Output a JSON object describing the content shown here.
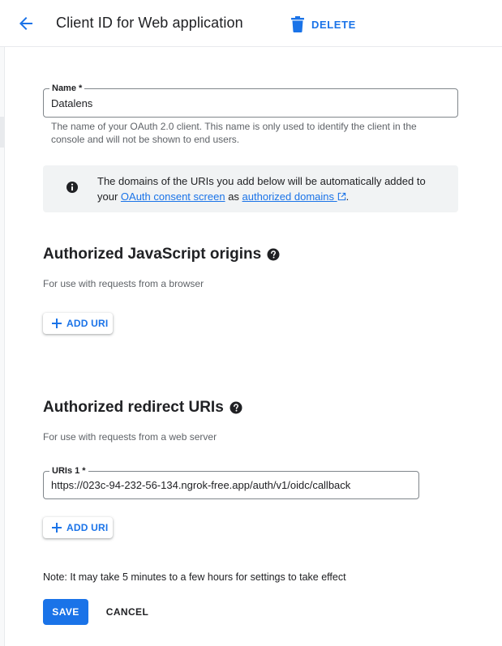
{
  "header": {
    "title": "Client ID for Web application",
    "delete_label": "DELETE",
    "back_icon": "arrow-back-icon",
    "delete_icon": "trash-icon"
  },
  "name_field": {
    "label": "Name *",
    "value": "Datalens",
    "helper": "The name of your OAuth 2.0 client. This name is only used to identify the client in the console and will not be shown to end users."
  },
  "info_box": {
    "icon": "info-icon",
    "text_part1": "The domains of the URIs you add below will be automatically added to your",
    "link1": "OAuth consent screen",
    "text_part2": "as",
    "link2": "authorized domains",
    "text_part3": "."
  },
  "js_origins": {
    "title": "Authorized JavaScript origins",
    "subtitle": "For use with requests from a browser",
    "add_label": "ADD URI"
  },
  "redirect_uris": {
    "title": "Authorized redirect URIs",
    "subtitle": "For use with requests from a web server",
    "uri_label": "URIs 1 *",
    "uri_value": "https://023c-94-232-56-134.ngrok-free.app/auth/v1/oidc/callback",
    "add_label": "ADD URI"
  },
  "note": "Note: It may take 5 minutes to a few hours for settings to take effect",
  "actions": {
    "save_label": "SAVE",
    "cancel_label": "CANCEL"
  },
  "colors": {
    "accent": "#1a73e8",
    "text": "#202124",
    "muted": "#5f6368",
    "info_bg": "#f1f3f4"
  }
}
